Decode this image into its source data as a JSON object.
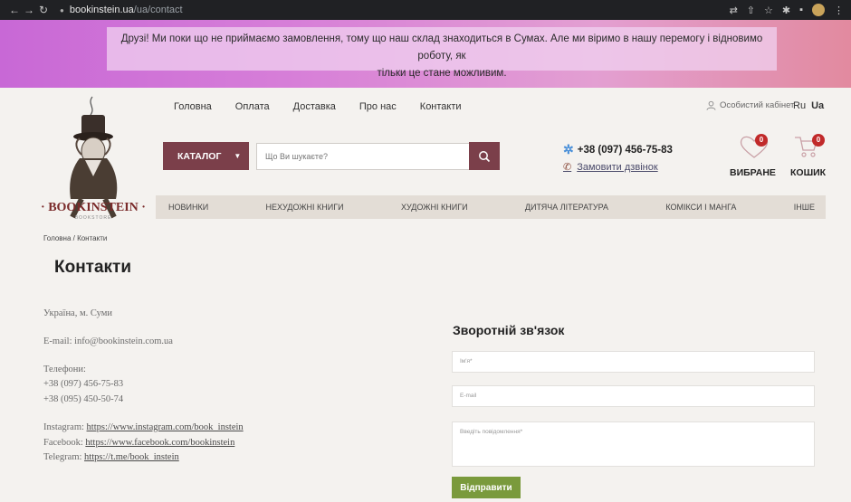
{
  "browser": {
    "url_domain": "bookinstein.ua",
    "url_path": "/ua/contact"
  },
  "banner": {
    "line1": "Друзі! Ми поки що не приймаємо замовлення, тому що наш склад знаходиться в Сумах. Але ми віримо в нашу перемогу і відновимо роботу, як",
    "line2": "тільки це стане можливим."
  },
  "logo": {
    "text": "· BOOKINSTEIN ·",
    "subtext": "BOOKSTORE"
  },
  "topnav": [
    "Головна",
    "Оплата",
    "Доставка",
    "Про нас",
    "Контакти"
  ],
  "account": {
    "cabinet_label": "Особистий кабінет",
    "lang_ru": "Ru",
    "lang_ua": "Ua"
  },
  "search": {
    "catalog_label": "КАТАЛОГ",
    "placeholder": "Що Ви шукаєте?"
  },
  "contact_header": {
    "phone": "+38 (097) 456-75-83",
    "callback": "Замовити дзвінок"
  },
  "favorites": {
    "label": "ВИБРАНЕ",
    "count": "0"
  },
  "cart": {
    "label": "КОШИК",
    "count": "0"
  },
  "categories": [
    "НОВИНКИ",
    "НЕХУДОЖНІ КНИГИ",
    "ХУДОЖНІ КНИГИ",
    "ДИТЯЧА ЛІТЕРАТУРА",
    "КОМІКСИ І МАНГА",
    "ІНШЕ"
  ],
  "breadcrumb": "Головна  /  Контакти",
  "page_title": "Контакти",
  "info": {
    "address": "Україна, м. Суми",
    "email": "E-mail: info@bookinstein.com.ua",
    "phones_label": "Телефони:",
    "phone1": "+38 (097) 456-75-83",
    "phone2": "+38 (095) 450-50-74",
    "instagram_label": "Instagram:",
    "instagram_link": "https://www.instagram.com/book_instein",
    "facebook_label": "Facebook:",
    "facebook_link": "https://www.facebook.com/bookinstein",
    "telegram_label": "Telegram:",
    "telegram_link": "https://t.me/book_instein"
  },
  "form": {
    "title": "Зворотній зв'язок",
    "name_placeholder": "Ім'я*",
    "email_placeholder": "E-mail",
    "message_placeholder": "Введіть повідомлення*",
    "submit_label": "Відправити"
  },
  "colors": {
    "accent": "#7b3f4a",
    "submit": "#7a9a3c",
    "badge": "#c12a2a"
  }
}
